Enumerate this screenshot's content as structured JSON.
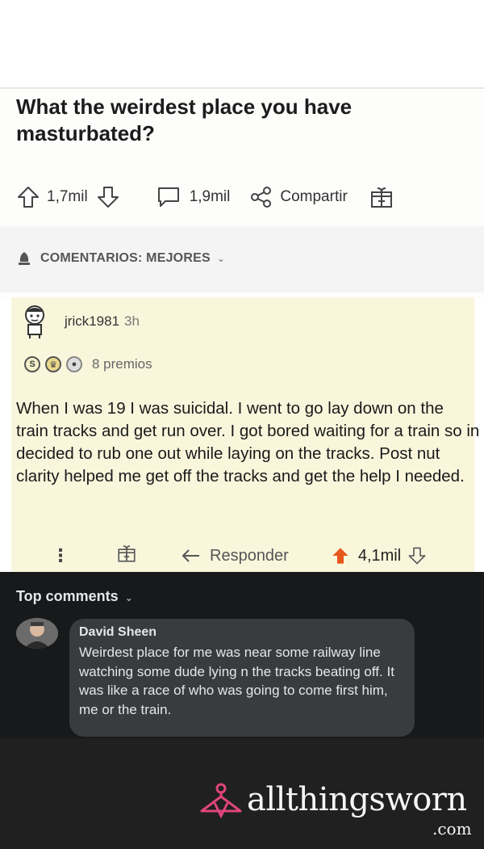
{
  "post": {
    "title": "What the weirdest place you have masturbated?",
    "upvotes": "1,7mil",
    "comments": "1,9mil",
    "share_label": "Compartir"
  },
  "sort": {
    "label": "COMENTARIOS: MEJORES"
  },
  "comment": {
    "username": "jrick1981",
    "time": "3h",
    "awards_label": "8 premios",
    "body": "When I was 19 I was suicidal. I went to go lay down on the train tracks and get run over. I got bored waiting for a train so in decided to rub one out while laying on the tracks. Post nut clarity helped me get off the tracks and get the help I needed.",
    "reply_label": "Responder",
    "votes": "4,1mil"
  },
  "facebook": {
    "section_label": "Top comments",
    "author": "David Sheen",
    "text": "Weirdest place for me was near some railway line watching some dude lying n the tracks beating off. It was like a race of who was going to come first him, me or the train."
  },
  "watermark": {
    "brand": "allthingsworn",
    "tld": ".com"
  },
  "colors": {
    "upvote_accent": "#e8561b",
    "comment_highlight": "#faf6dc",
    "dark_bg": "#18191a",
    "bubble_bg": "#3a3b3c",
    "watermark_accent": "#e0457b"
  }
}
